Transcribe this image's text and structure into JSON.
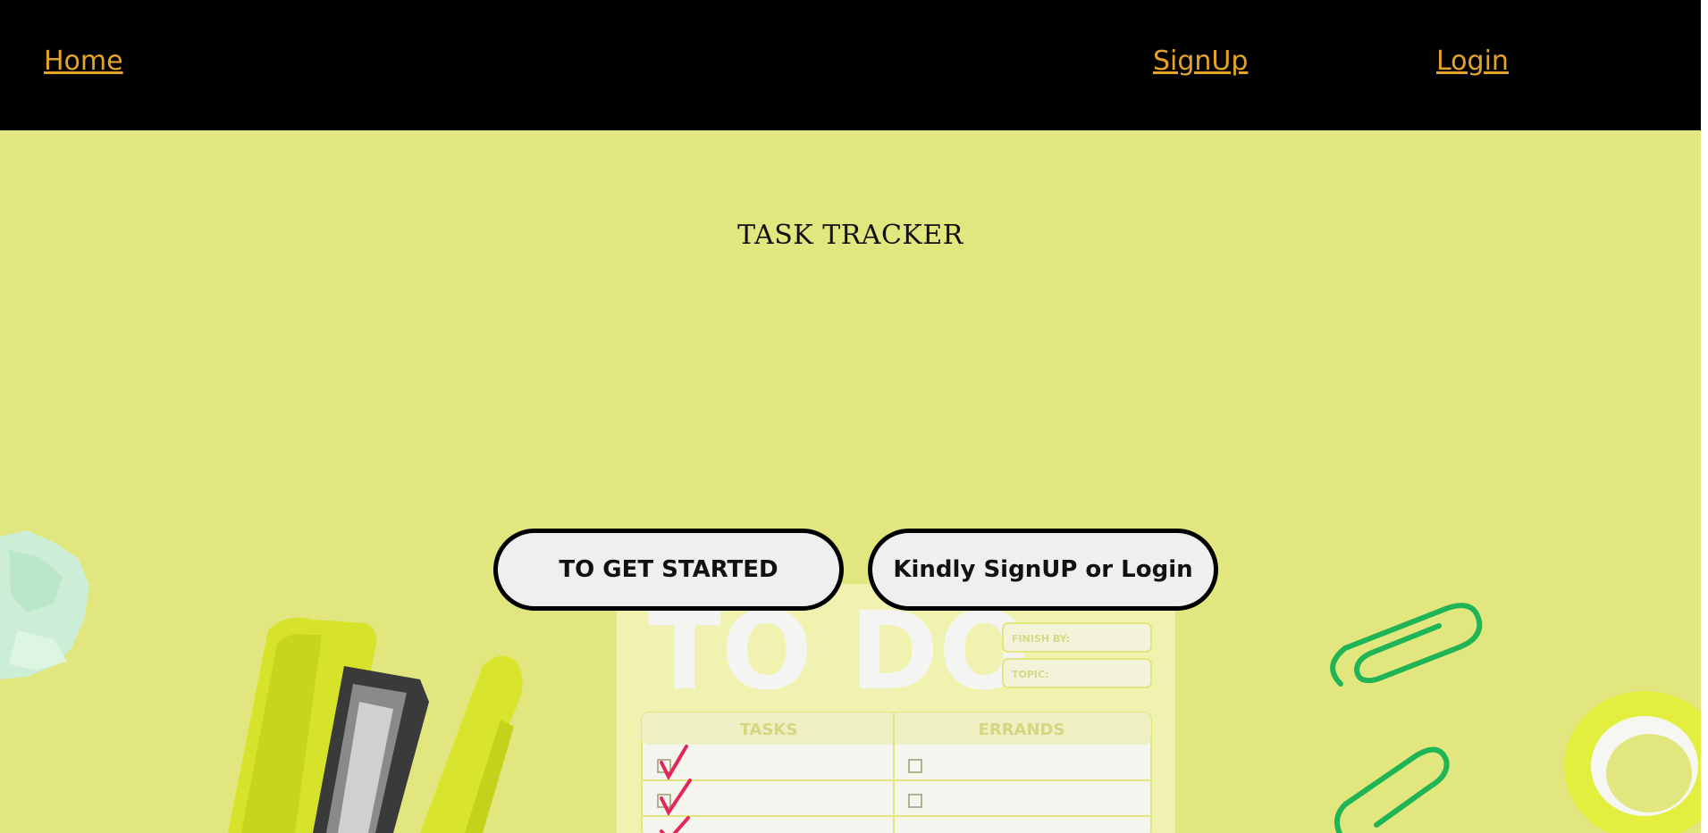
{
  "nav": {
    "home_label": "Home",
    "signup_label": "SignUp",
    "login_label": "Login"
  },
  "hero": {
    "title": "TASK TRACKER",
    "start_button_label": "TO GET STARTED",
    "signup_login_button_label": "Kindly SignUP or Login",
    "background_color": "#e2e67e"
  },
  "notepad": {
    "heading": "TO DO",
    "finish_by_label": "FINISH BY:",
    "topic_label": "TOPIC:",
    "tasks_header": "TASKS",
    "errands_header": "ERRANDS"
  },
  "colors": {
    "navbar": "#000000",
    "link": "#e3a428",
    "button_bg": "#efefef",
    "button_border": "#000000"
  }
}
